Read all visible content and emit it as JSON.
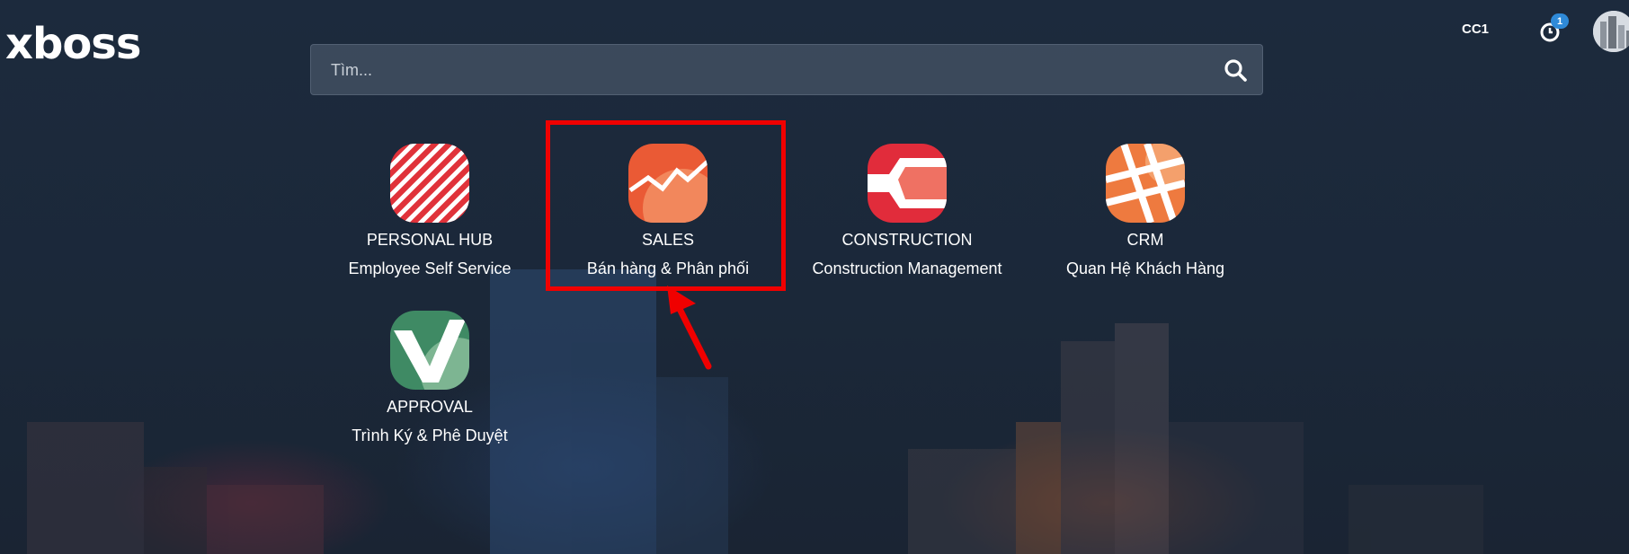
{
  "brand": {
    "logo_text": "xboss"
  },
  "topbar": {
    "company": "CC1",
    "activity_count": "1"
  },
  "search": {
    "placeholder": "Tìm...",
    "value": ""
  },
  "apps": [
    {
      "name": "PERSONAL HUB",
      "description": "Employee Self Service",
      "icon": "personal-hub-icon"
    },
    {
      "name": "SALES",
      "description": "Bán hàng & Phân phối",
      "icon": "sales-icon"
    },
    {
      "name": "CONSTRUCTION",
      "description": "Construction Management",
      "icon": "construction-icon"
    },
    {
      "name": "CRM",
      "description": "Quan Hệ Khách Hàng",
      "icon": "crm-icon"
    },
    {
      "name": "APPROVAL",
      "description": "Trình Ký & Phê Duyệt",
      "icon": "approval-icon"
    }
  ],
  "colors": {
    "highlight": "#f00000",
    "badge": "#2f8ad8",
    "background": "#1c2a3d"
  }
}
